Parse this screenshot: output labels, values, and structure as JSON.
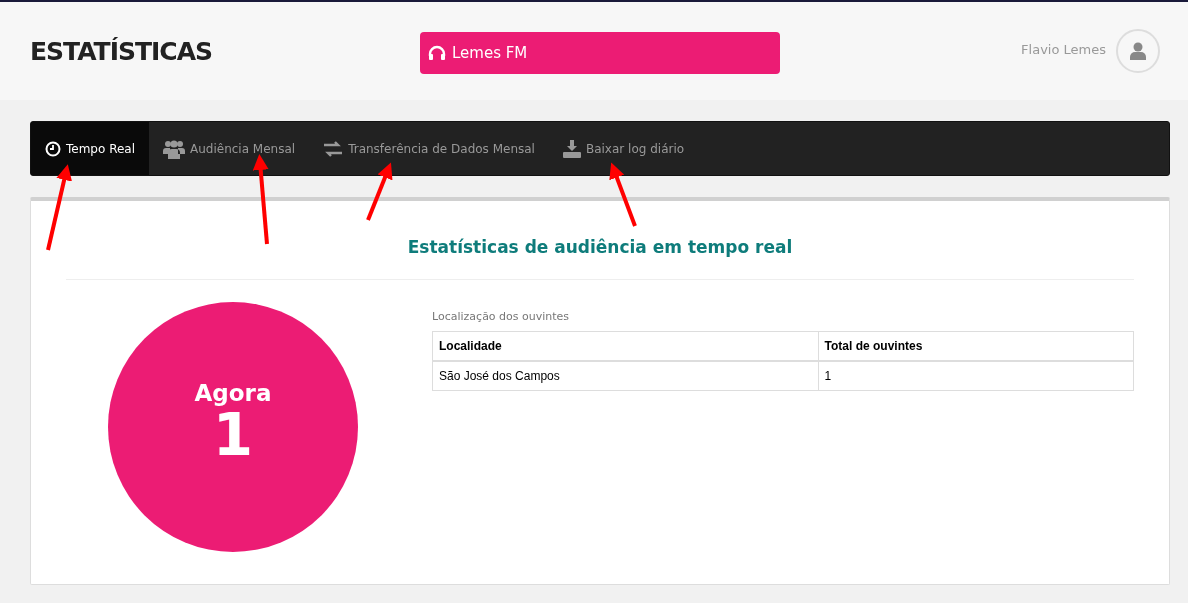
{
  "header": {
    "title": "ESTATÍSTICAS",
    "station": "Lemes FM",
    "user": "Flavio Lemes"
  },
  "tabs": [
    {
      "kind": "clock",
      "label": "Tempo Real",
      "selected": true
    },
    {
      "kind": "users",
      "label": "Audiência Mensal",
      "selected": false
    },
    {
      "kind": "transfer",
      "label": "Transferência de Dados Mensal",
      "selected": false
    },
    {
      "kind": "download",
      "label": "Baixar log diário",
      "selected": false
    }
  ],
  "panel": {
    "title": "Estatísticas de audiência em tempo real",
    "now_label": "Agora",
    "now_value": "1",
    "table": {
      "caption": "Localização dos ouvintes",
      "columns": [
        "Localidade",
        "Total de ouvintes"
      ],
      "rows": [
        [
          "São José dos Campos",
          "1"
        ]
      ]
    }
  }
}
